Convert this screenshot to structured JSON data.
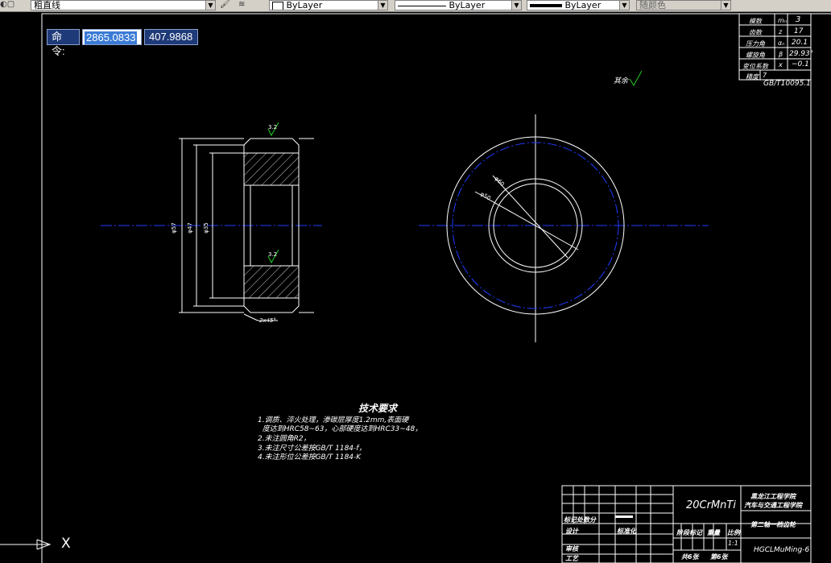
{
  "toolbar": {
    "linetype_name": "粗直线",
    "layer_color": "ByLayer",
    "layer_linetype": "ByLayer",
    "layer_lineweight": "ByLayer",
    "plot_style": "随颜色"
  },
  "command": {
    "label": "命令:",
    "x_value": "2865.0833",
    "y_value": "407.9868"
  },
  "params_table": {
    "rows": [
      {
        "name": "模数",
        "symbol": "mₙ",
        "value": "3"
      },
      {
        "name": "齿数",
        "symbol": "z",
        "value": "17"
      },
      {
        "name": "压力角",
        "symbol": "αₙ",
        "value": "20.1"
      },
      {
        "name": "螺旋角",
        "symbol": "β",
        "value": "29.93°"
      },
      {
        "name": "变位系数",
        "symbol": "x",
        "value": "−0.1"
      },
      {
        "name": "精度",
        "symbol": "7",
        "value": ""
      }
    ],
    "standard": "GB/T10095.1"
  },
  "surface_note": {
    "rest": "其余",
    "finish_top": "3.2",
    "finish_bottom": "3.2"
  },
  "dimensions": {
    "d1": "φ57",
    "d2": "φ47",
    "d3": "φ35",
    "chamfer": "2x45°",
    "radius1": "φ60",
    "radius2": "φ50"
  },
  "tech_requirements": {
    "title": "技术要求",
    "items": [
      "1.调质、淬火处理，渗碳层厚度1.2mm,表面硬",
      "  度达到HRC58~63，心部硬度达到HRC33~48，",
      "2.未注圆角R2，",
      "3.未注尺寸公差按GB/T 1184-f，",
      "4.未注形位公差按GB/T 1184-K"
    ]
  },
  "title_block": {
    "material": "20CrMnTi",
    "school": "黑龙江工程学院",
    "dept": "汽车与交通工程学院",
    "part_name": "第二轴一档齿轮",
    "drawing_no": "HGCLMuMing-6",
    "scale_label": "比例",
    "scale": "1:1",
    "weight_label": "重量",
    "stage_label": "阶段标记",
    "total_sheets": "共6张",
    "sheet_no": "第6张",
    "mark_label": "标记处数分",
    "design_label": "设计",
    "std_label": "标准化",
    "review_label": "审核",
    "craft_label": "工艺"
  },
  "ucs": {
    "x_label": "X"
  },
  "colors": {
    "background": "#000000",
    "line": "#ffffff",
    "centerline": "#1e3cff",
    "hatch": "#ffffff",
    "surface_mark": "#22cc22",
    "cmd_bg": "#1f3a78",
    "cmd_selected": "#3a7bd5"
  }
}
